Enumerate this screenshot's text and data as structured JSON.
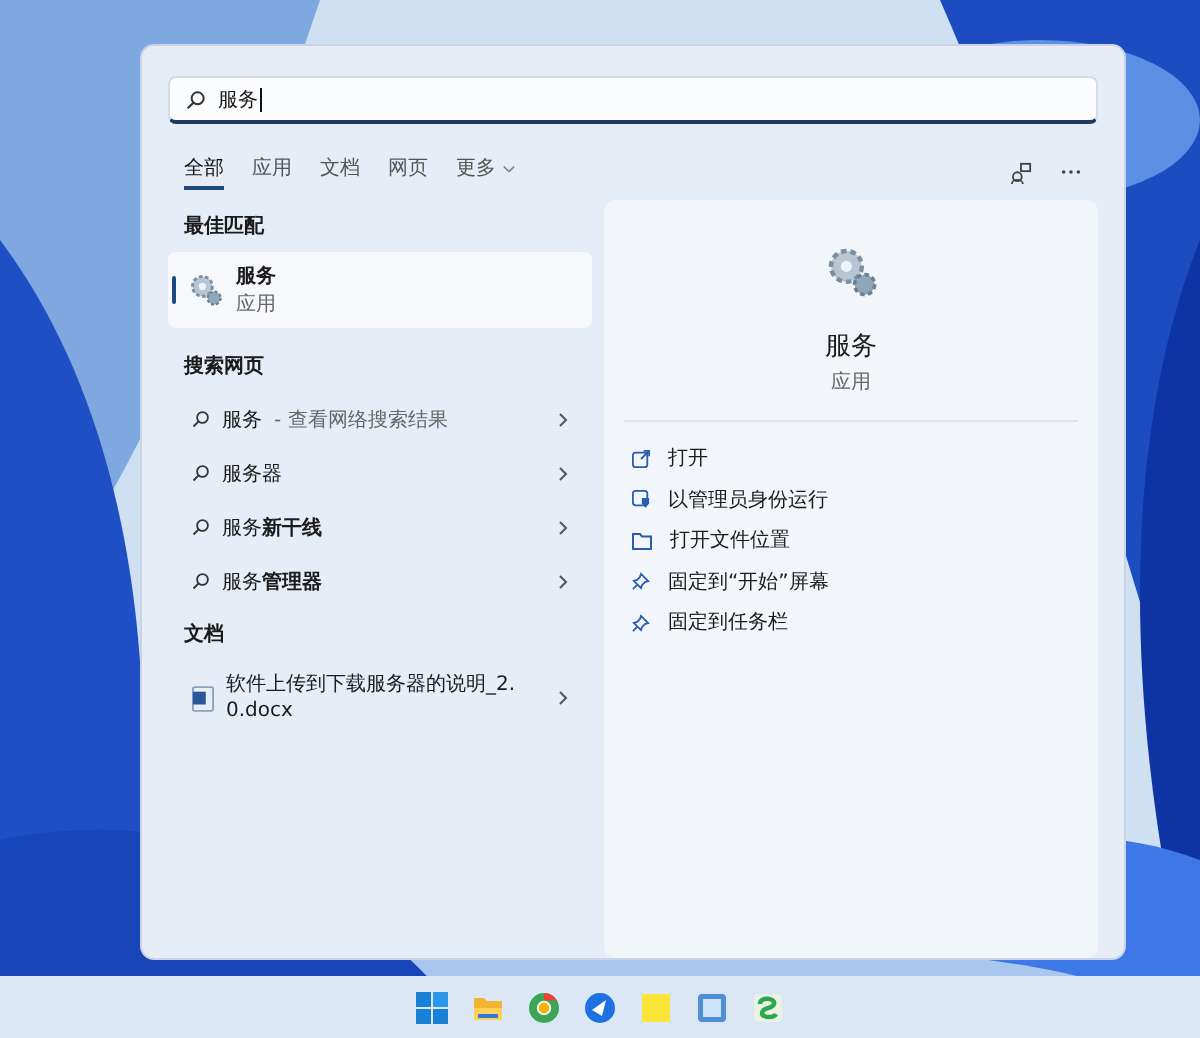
{
  "search": {
    "value": "服务"
  },
  "tabs": [
    {
      "label": "全部",
      "selected": true
    },
    {
      "label": "应用",
      "selected": false
    },
    {
      "label": "文档",
      "selected": false
    },
    {
      "label": "网页",
      "selected": false
    }
  ],
  "more_tab": {
    "label": "更多"
  },
  "best_match": {
    "heading": "最佳匹配",
    "title": "服务",
    "subtitle": "应用",
    "selected": true
  },
  "web_search": {
    "heading": "搜索网页",
    "items": [
      {
        "text": "服务",
        "hint": "- 查看网络搜索结果"
      },
      {
        "text": "服务器"
      },
      {
        "text": "服务**新干线**"
      },
      {
        "text": "服务**管理器**"
      }
    ]
  },
  "documents": {
    "heading": "文档",
    "items": [
      {
        "name": "软件上传到下载服务器的说明_2.0.docx"
      }
    ]
  },
  "details": {
    "title": "服务",
    "subtitle": "应用",
    "actions": [
      {
        "label": "打开",
        "kind": "open"
      },
      {
        "label": "以管理员身份运行",
        "kind": "admin"
      },
      {
        "label": "打开文件位置",
        "kind": "folder"
      },
      {
        "label": "固定到“开始”屏幕",
        "kind": "pin"
      },
      {
        "label": "固定到任务栏",
        "kind": "pin"
      }
    ]
  }
}
